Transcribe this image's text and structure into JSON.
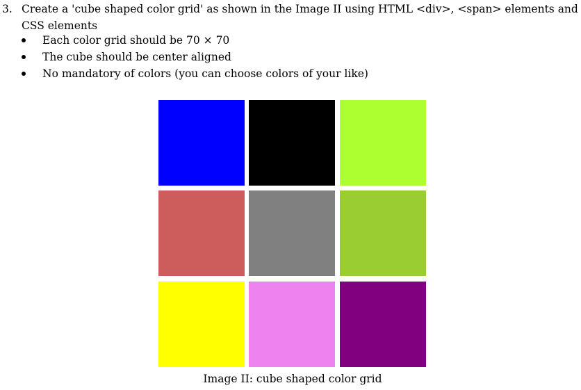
{
  "question": {
    "number": "3.",
    "text": "Create a 'cube shaped color grid' as shown in the Image II using HTML <div>, <span> elements and CSS elements",
    "bullets": [
      "Each color grid should be 70 × 70",
      "The cube should be center aligned",
      "No mandatory of colors (you can choose colors of your like)"
    ]
  },
  "grid": {
    "colors": [
      "#0000FF",
      "#000000",
      "#ADFF2F",
      "#CD5C5C",
      "#808080",
      "#9ACD32",
      "#FFFF00",
      "#EE82EE",
      "#800080"
    ],
    "color_names": [
      "blue",
      "black",
      "greenyellow",
      "indianred",
      "gray",
      "yellowgreen",
      "yellow",
      "violet",
      "purple"
    ]
  },
  "caption": "Image II: cube shaped color grid"
}
